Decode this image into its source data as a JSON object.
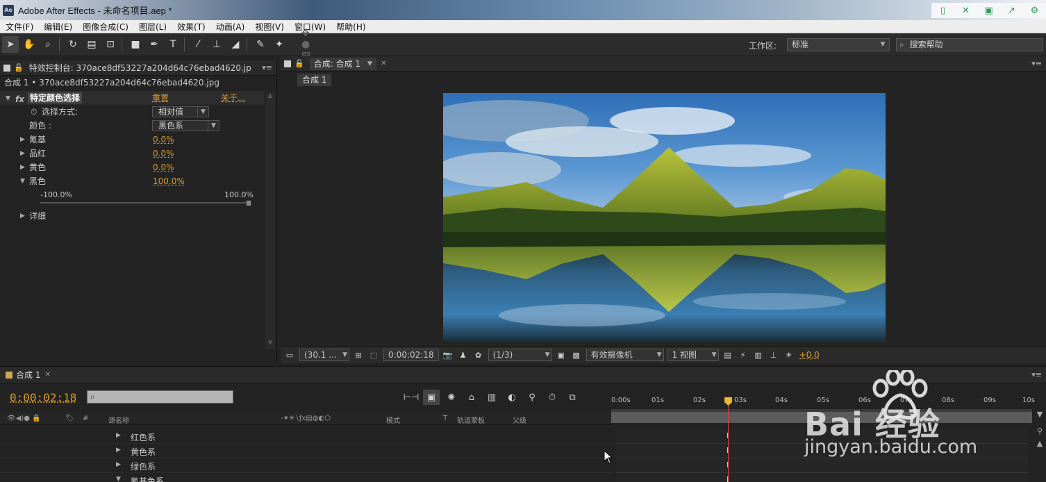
{
  "window": {
    "app_icon": "Ae",
    "title": "Adobe After Effects - 未命名项目.aep *"
  },
  "menu": [
    "文件(F)",
    "编辑(E)",
    "图像合成(C)",
    "图层(L)",
    "效果(T)",
    "动画(A)",
    "视图(V)",
    "窗口(W)",
    "帮助(H)"
  ],
  "toolbar": {
    "workspace_label": "工作区:",
    "workspace_value": "标准",
    "search_help": "搜索帮助"
  },
  "effects_panel": {
    "tab_label": "特效控制台: 370ace8df53227a204d64c76ebad4620.jp",
    "subtitle": "合成 1 • 370ace8df53227a204d64c76ebad4620.jpg",
    "effect_name": "特定颜色选择",
    "reset": "重置",
    "about": "关于...",
    "method_label": "选择方式:",
    "method_value": "相对值",
    "color_label": "颜色 :",
    "color_value": "黑色系",
    "cyan_label": "氰基",
    "cyan_value": "0.0%",
    "magenta_label": "品红",
    "magenta_value": "0.0%",
    "yellow_label": "黄色",
    "yellow_value": "0.0%",
    "black_label": "黑色",
    "black_value": "100.0%",
    "slider_min": "-100.0%",
    "slider_max": "100.0%",
    "slider_value": 1.0,
    "details_label": "详细"
  },
  "comp_panel": {
    "tab_label": "合成: 合成 1",
    "breadcrumb": "合成 1",
    "zoom": "(30.1 ...",
    "timecode": "0:00:02:18",
    "resolution": "(1/3)",
    "camera": "有效摄像机",
    "views": "1 视图",
    "exposure": "+0.0"
  },
  "timeline": {
    "tab_label": "合成 1",
    "current_time": "0:00:02:18",
    "search_icon": "search-icon",
    "columns": {
      "source_name": "源名称",
      "mode": "模式",
      "t": "T",
      "track_matte": "轨道蒙板",
      "parent": "父级",
      "hash": "#"
    },
    "layers": [
      "红色系",
      "黄色系",
      "绿色系",
      "氰基色系"
    ],
    "ruler_ticks": [
      "0:00s",
      "01s",
      "02s",
      "03s",
      "04s",
      "05s",
      "06s",
      "07s",
      "08s",
      "09s",
      "10s"
    ]
  },
  "watermark": {
    "line1": "Bai 经验",
    "line2": "jingyan.baidu.com"
  }
}
